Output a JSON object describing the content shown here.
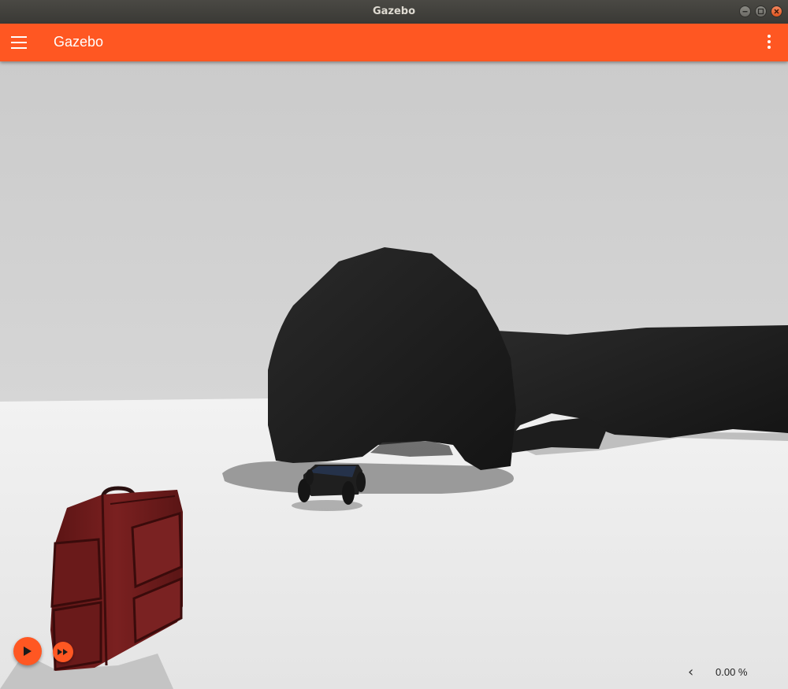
{
  "window": {
    "title": "Gazebo"
  },
  "appbar": {
    "title": "Gazebo"
  },
  "controls": {
    "play_icon": "play-icon",
    "step_icon": "fast-forward-icon",
    "rtf_toggle": "‹",
    "real_time_factor": "0.00 %"
  },
  "colors": {
    "accent": "#ff5722",
    "titlebar": "#3c3b37",
    "sky": "#cfcfcf",
    "ground": "#ececec"
  }
}
